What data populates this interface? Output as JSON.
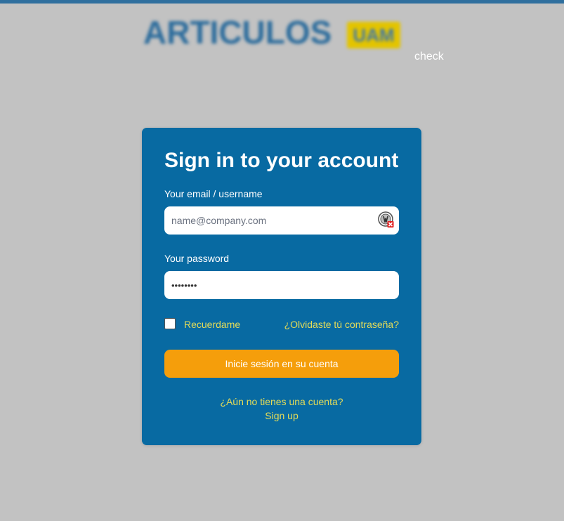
{
  "header": {
    "brand_title": "ARTICULOS",
    "brand_badge": "UAM",
    "check_text": "check"
  },
  "login": {
    "title": "Sign in to your account",
    "email_label": "Your email / username",
    "email_placeholder": "name@company.com",
    "email_value": "",
    "password_label": "Your password",
    "password_value": "••••••••",
    "remember_label": "Recuerdame",
    "remember_checked": false,
    "forgot_link": "¿Olvidaste tú contraseña?",
    "submit_label": "Inicie sesión en su cuenta",
    "no_account_text": "¿Aún no tienes una cuenta?",
    "signup_link": "Sign up",
    "autofill_icon": "password-manager-icon"
  },
  "colors": {
    "background": "#c2c2c2",
    "card": "#086aa2",
    "accent_link": "#e4dc58",
    "button": "#f59e0b",
    "brand_blue": "#2c6c9c",
    "badge_yellow": "#e3c400"
  }
}
